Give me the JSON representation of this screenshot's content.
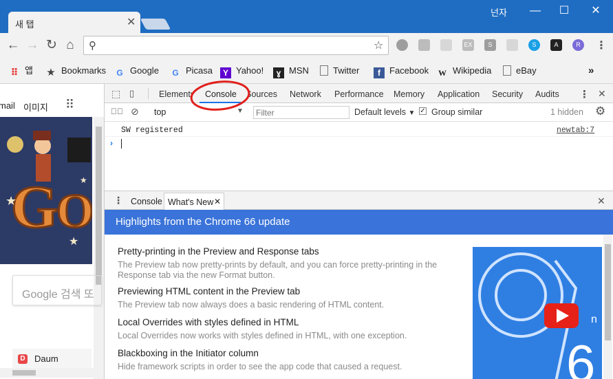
{
  "window": {
    "user_label": "넌자"
  },
  "tab": {
    "title": "새 탭"
  },
  "bookmarks": [
    {
      "label": "앱"
    },
    {
      "label": "Bookmarks"
    },
    {
      "label": "Google"
    },
    {
      "label": "Picasa"
    },
    {
      "label": "Yahoo!"
    },
    {
      "label": "MSN"
    },
    {
      "label": "Twitter"
    },
    {
      "label": "Facebook"
    },
    {
      "label": "Wikipedia"
    },
    {
      "label": "eBay"
    }
  ],
  "page": {
    "gmail_partial": "mail",
    "images_label": "이미지",
    "search_placeholder": "Google 검색 또",
    "shortcut_label": "Daum"
  },
  "devtools": {
    "tabs": [
      "Elements",
      "Console",
      "Sources",
      "Network",
      "Performance",
      "Memory",
      "Application",
      "Security",
      "Audits"
    ],
    "active_tab": "Console",
    "context": "top",
    "filter_placeholder": "Filter",
    "levels": "Default levels",
    "group_similar": "Group similar",
    "hidden": "1 hidden",
    "log_message": "SW registered",
    "log_source": "newtab:7",
    "drawer_tabs": [
      "Console",
      "What's New"
    ],
    "banner": "Highlights from the Chrome 66 update",
    "items": [
      {
        "title": "Pretty-printing in the Preview and Response tabs",
        "desc": "The Preview tab now pretty-prints by default, and you can force pretty-printing in the Response tab via the new Format button."
      },
      {
        "title": "Previewing HTML content in the Preview tab",
        "desc": "The Preview tab now always does a basic rendering of HTML content."
      },
      {
        "title": "Local Overrides with styles defined in HTML",
        "desc": "Local Overrides now works with styles defined in HTML, with one exception."
      },
      {
        "title": "Blackboxing in the Initiator column",
        "desc": "Hide framework scripts in order to see the app code that caused a request."
      }
    ]
  },
  "colors": {
    "titlebar": "#1f6dc2",
    "banner": "#3a73d9",
    "highlight_circle": "#e0201c"
  }
}
